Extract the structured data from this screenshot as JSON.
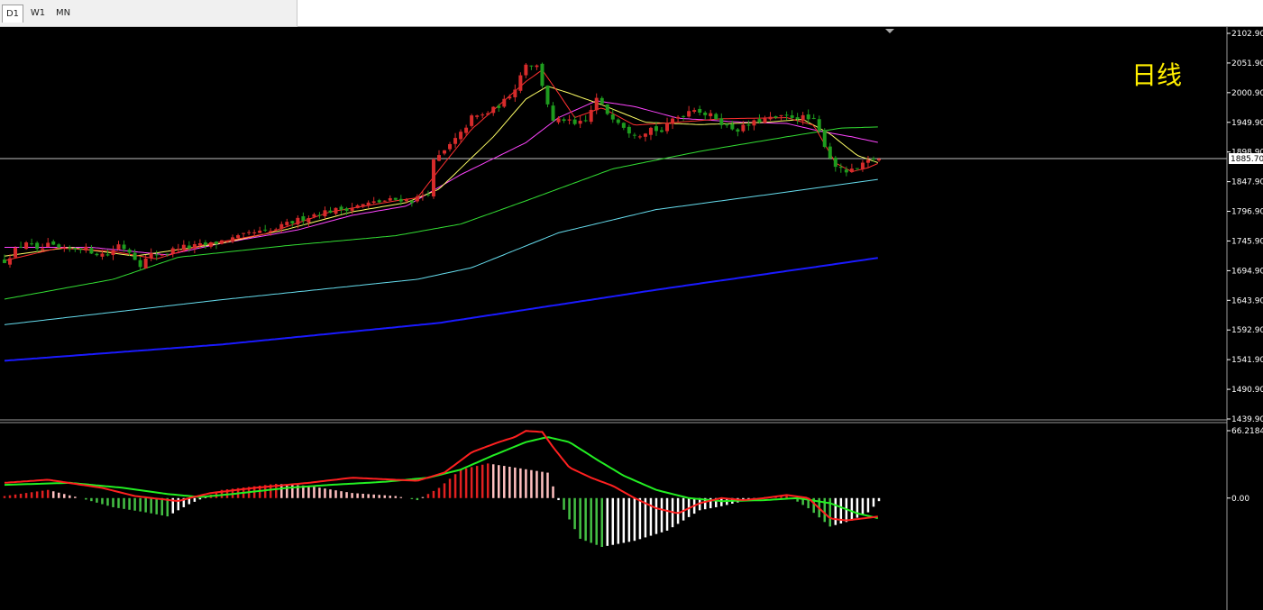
{
  "toolbar": {
    "tabs": [
      {
        "label": "D1",
        "active": true
      },
      {
        "label": "W1",
        "active": false
      },
      {
        "label": "MN",
        "active": false
      }
    ]
  },
  "annotation": "日线",
  "current_price": "1885.70",
  "colors": {
    "background": "#000000",
    "bull_candle": "#d72b2b",
    "bear_candle": "#1e9b1e",
    "ma5": "#ff3030",
    "ma10": "#ffff66",
    "ma20": "#ff44ff",
    "ma60": "#33dd33",
    "ma120": "#66ddee",
    "ma250": "#1a1aff",
    "dif": "#ff2020",
    "dea": "#22ee22",
    "hist_pos": "#e02020",
    "hist_pos_fade": "#ffc0c0",
    "hist_neg": "#44c044",
    "hist_neg_fade": "#ffffff"
  },
  "chart_data": [
    {
      "type": "candlestick",
      "ylim": [
        1439.9,
        2102.9
      ],
      "yticks": [
        "2102.90",
        "2051.90",
        "2000.90",
        "1949.90",
        "1898.90",
        "1847.90",
        "1796.90",
        "1745.90",
        "1694.90",
        "1643.90",
        "1592.90",
        "1541.90",
        "1490.90",
        "1439.90"
      ],
      "current": 1885.7,
      "anchors": [
        [
          0,
          1712
        ],
        [
          10,
          1730
        ],
        [
          20,
          1745
        ],
        [
          30,
          1728
        ],
        [
          40,
          1738
        ],
        [
          55,
          1730
        ],
        [
          70,
          1735
        ],
        [
          85,
          1725
        ],
        [
          95,
          1722
        ],
        [
          105,
          1740
        ],
        [
          115,
          1728
        ],
        [
          125,
          1706
        ],
        [
          135,
          1722
        ],
        [
          150,
          1725
        ],
        [
          160,
          1736
        ],
        [
          170,
          1735
        ],
        [
          180,
          1738
        ],
        [
          190,
          1740
        ],
        [
          200,
          1746
        ],
        [
          215,
          1752
        ],
        [
          230,
          1760
        ],
        [
          245,
          1762
        ],
        [
          260,
          1775
        ],
        [
          275,
          1785
        ],
        [
          290,
          1795
        ],
        [
          305,
          1799
        ],
        [
          320,
          1804
        ],
        [
          335,
          1810
        ],
        [
          350,
          1815
        ],
        [
          365,
          1818
        ],
        [
          375,
          1815
        ],
        [
          390,
          1830
        ],
        [
          395,
          1882
        ],
        [
          405,
          1900
        ],
        [
          420,
          1930
        ],
        [
          430,
          1958
        ],
        [
          440,
          1962
        ],
        [
          450,
          1972
        ],
        [
          460,
          1986
        ],
        [
          470,
          2010
        ],
        [
          480,
          2052
        ],
        [
          490,
          2046
        ],
        [
          495,
          2015
        ],
        [
          505,
          1950
        ],
        [
          515,
          1955
        ],
        [
          525,
          1945
        ],
        [
          535,
          1952
        ],
        [
          545,
          1990
        ],
        [
          555,
          1966
        ],
        [
          565,
          1953
        ],
        [
          575,
          1935
        ],
        [
          585,
          1930
        ],
        [
          595,
          1940
        ],
        [
          605,
          1934
        ],
        [
          615,
          1955
        ],
        [
          625,
          1965
        ],
        [
          635,
          1975
        ],
        [
          645,
          1964
        ],
        [
          655,
          1958
        ],
        [
          665,
          1942
        ],
        [
          675,
          1938
        ],
        [
          685,
          1945
        ],
        [
          695,
          1953
        ],
        [
          705,
          1956
        ],
        [
          715,
          1958
        ],
        [
          725,
          1960
        ],
        [
          735,
          1958
        ],
        [
          745,
          1952
        ],
        [
          752,
          1925
        ],
        [
          760,
          1890
        ],
        [
          768,
          1868
        ],
        [
          778,
          1864
        ],
        [
          785,
          1870
        ],
        [
          792,
          1878
        ],
        [
          799,
          1888
        ],
        [
          805,
          1886
        ]
      ],
      "moving_averages": [
        {
          "period": 250,
          "anchors": [
            [
              0,
              1540
            ],
            [
              200,
              1568
            ],
            [
              400,
              1605
            ],
            [
              600,
              1662
            ],
            [
              805,
              1717
            ]
          ]
        },
        {
          "period": 120,
          "anchors": [
            [
              0,
              1602
            ],
            [
              200,
              1645
            ],
            [
              380,
              1680
            ],
            [
              430,
              1700
            ],
            [
              510,
              1760
            ],
            [
              600,
              1800
            ],
            [
              700,
              1825
            ],
            [
              805,
              1852
            ]
          ]
        },
        {
          "period": 60,
          "anchors": [
            [
              0,
              1646
            ],
            [
              100,
              1680
            ],
            [
              160,
              1718
            ],
            [
              260,
              1738
            ],
            [
              360,
              1755
            ],
            [
              420,
              1775
            ],
            [
              480,
              1815
            ],
            [
              560,
              1870
            ],
            [
              640,
              1900
            ],
            [
              720,
              1925
            ],
            [
              770,
              1940
            ],
            [
              805,
              1942
            ]
          ]
        },
        {
          "period": 20,
          "anchors": [
            [
              0,
              1735
            ],
            [
              80,
              1735
            ],
            [
              150,
              1722
            ],
            [
              200,
              1742
            ],
            [
              270,
              1765
            ],
            [
              320,
              1790
            ],
            [
              370,
              1806
            ],
            [
              420,
              1860
            ],
            [
              480,
              1915
            ],
            [
              510,
              1958
            ],
            [
              545,
              1987
            ],
            [
              580,
              1977
            ],
            [
              620,
              1957
            ],
            [
              680,
              1950
            ],
            [
              720,
              1948
            ],
            [
              750,
              1935
            ],
            [
              780,
              1925
            ],
            [
              805,
              1915
            ]
          ]
        },
        {
          "period": 10,
          "anchors": [
            [
              0,
              1720
            ],
            [
              60,
              1735
            ],
            [
              120,
              1720
            ],
            [
              200,
              1742
            ],
            [
              260,
              1766
            ],
            [
              320,
              1796
            ],
            [
              370,
              1812
            ],
            [
              400,
              1835
            ],
            [
              450,
              1925
            ],
            [
              480,
              1990
            ],
            [
              500,
              2012
            ],
            [
              520,
              2000
            ],
            [
              550,
              1980
            ],
            [
              590,
              1950
            ],
            [
              640,
              1946
            ],
            [
              700,
              1950
            ],
            [
              735,
              1955
            ],
            [
              760,
              1930
            ],
            [
              785,
              1893
            ],
            [
              805,
              1880
            ]
          ]
        },
        {
          "period": 5,
          "anchors": [
            [
              0,
              1712
            ],
            [
              50,
              1734
            ],
            [
              100,
              1728
            ],
            [
              140,
              1715
            ],
            [
              180,
              1738
            ],
            [
              240,
              1758
            ],
            [
              300,
              1796
            ],
            [
              360,
              1815
            ],
            [
              380,
              1820
            ],
            [
              400,
              1868
            ],
            [
              430,
              1938
            ],
            [
              480,
              2020
            ],
            [
              495,
              2040
            ],
            [
              510,
              2000
            ],
            [
              525,
              1958
            ],
            [
              550,
              1975
            ],
            [
              580,
              1945
            ],
            [
              620,
              1950
            ],
            [
              660,
              1956
            ],
            [
              720,
              1958
            ],
            [
              745,
              1945
            ],
            [
              765,
              1880
            ],
            [
              780,
              1865
            ],
            [
              795,
              1872
            ],
            [
              805,
              1880
            ]
          ]
        }
      ]
    },
    {
      "type": "macd",
      "ylim": [
        -110,
        66.2184
      ],
      "yticks": [
        "66.2184",
        "0.00"
      ],
      "dif_anchors": [
        [
          0,
          15
        ],
        [
          40,
          18
        ],
        [
          90,
          10
        ],
        [
          120,
          2
        ],
        [
          160,
          -3
        ],
        [
          170,
          0
        ],
        [
          190,
          5
        ],
        [
          230,
          10
        ],
        [
          280,
          15
        ],
        [
          320,
          20
        ],
        [
          380,
          17
        ],
        [
          405,
          25
        ],
        [
          430,
          45
        ],
        [
          455,
          55
        ],
        [
          470,
          60
        ],
        [
          480,
          66
        ],
        [
          495,
          65
        ],
        [
          505,
          50
        ],
        [
          520,
          30
        ],
        [
          540,
          20
        ],
        [
          560,
          12
        ],
        [
          580,
          0
        ],
        [
          600,
          -10
        ],
        [
          620,
          -15
        ],
        [
          640,
          -5
        ],
        [
          660,
          0
        ],
        [
          680,
          -2
        ],
        [
          700,
          0
        ],
        [
          720,
          3
        ],
        [
          740,
          0
        ],
        [
          760,
          -20
        ],
        [
          775,
          -22
        ],
        [
          790,
          -20
        ],
        [
          805,
          -18
        ]
      ],
      "dea_anchors": [
        [
          0,
          13
        ],
        [
          60,
          15
        ],
        [
          110,
          10
        ],
        [
          150,
          4
        ],
        [
          180,
          1
        ],
        [
          210,
          4
        ],
        [
          260,
          10
        ],
        [
          300,
          13
        ],
        [
          350,
          16
        ],
        [
          390,
          20
        ],
        [
          420,
          28
        ],
        [
          450,
          42
        ],
        [
          480,
          55
        ],
        [
          500,
          60
        ],
        [
          520,
          55
        ],
        [
          545,
          38
        ],
        [
          570,
          22
        ],
        [
          600,
          8
        ],
        [
          630,
          0
        ],
        [
          660,
          -3
        ],
        [
          700,
          -2
        ],
        [
          730,
          0
        ],
        [
          760,
          -5
        ],
        [
          785,
          -15
        ],
        [
          805,
          -20
        ]
      ],
      "hist_anchors": [
        [
          0,
          2
        ],
        [
          40,
          8
        ],
        [
          70,
          0
        ],
        [
          100,
          -9
        ],
        [
          130,
          -14
        ],
        [
          150,
          -18
        ],
        [
          170,
          -6
        ],
        [
          200,
          8
        ],
        [
          250,
          14
        ],
        [
          280,
          12
        ],
        [
          320,
          5
        ],
        [
          360,
          2
        ],
        [
          380,
          -2
        ],
        [
          400,
          10
        ],
        [
          420,
          28
        ],
        [
          445,
          34
        ],
        [
          470,
          30
        ],
        [
          500,
          25
        ],
        [
          510,
          -2
        ],
        [
          530,
          -40
        ],
        [
          550,
          -48
        ],
        [
          580,
          -42
        ],
        [
          610,
          -32
        ],
        [
          640,
          -12
        ],
        [
          660,
          -8
        ],
        [
          680,
          -3
        ],
        [
          700,
          1
        ],
        [
          720,
          3
        ],
        [
          740,
          -10
        ],
        [
          760,
          -28
        ],
        [
          780,
          -22
        ],
        [
          795,
          -14
        ],
        [
          805,
          -3
        ]
      ]
    }
  ]
}
